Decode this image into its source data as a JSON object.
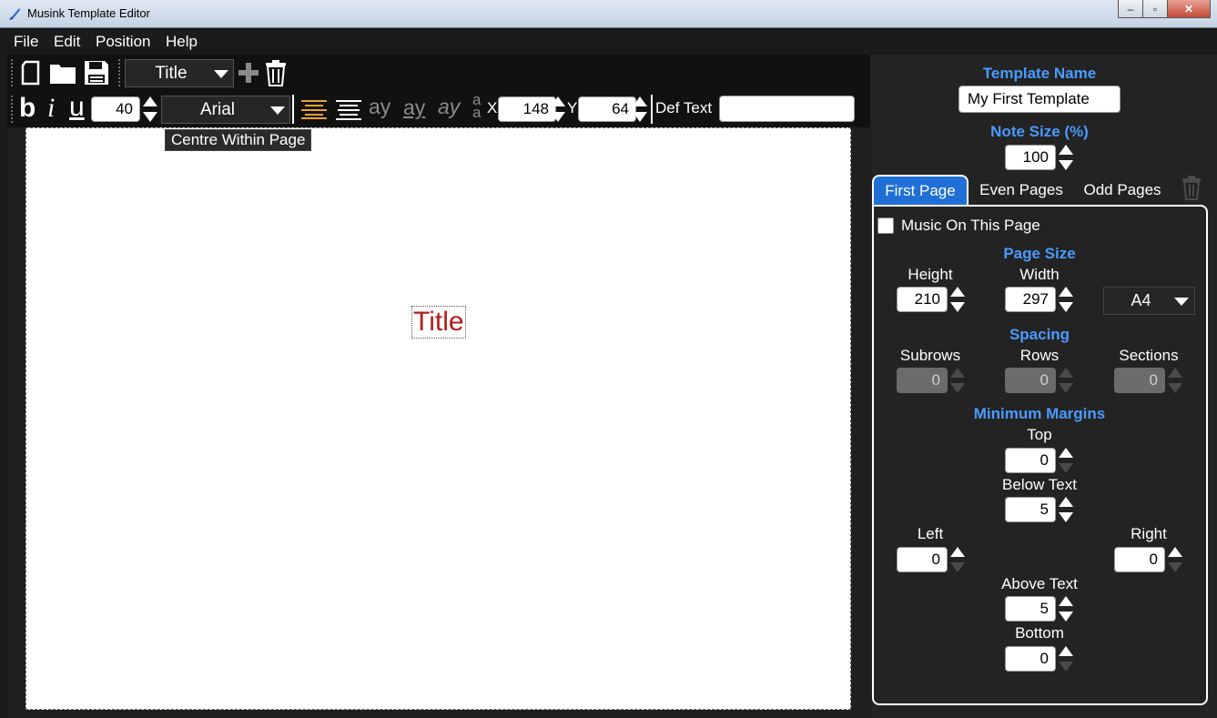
{
  "window": {
    "title": "Musink Template Editor",
    "minimize": "‒",
    "maximize": "▫",
    "close": "✕"
  },
  "menu": {
    "file": "File",
    "edit": "Edit",
    "position": "Position",
    "help": "Help"
  },
  "toolbar": {
    "element_select": "Title",
    "bold": "b",
    "italic": "i",
    "underline": "u",
    "font_size": "40",
    "font": "Arial",
    "style_a": "ay",
    "style_b": "ay",
    "style_c": "ay",
    "style_d": "a",
    "x_label": "X",
    "x_value": "148",
    "y_label": "Y",
    "y_value": "64",
    "def_text_label": "Def Text",
    "def_text_value": "",
    "tooltip": "Centre Within Page"
  },
  "canvas": {
    "title_element": "Title"
  },
  "panel": {
    "template_name_label": "Template Name",
    "template_name_value": "My First Template",
    "note_size_label": "Note Size (%)",
    "note_size_value": "100",
    "tabs": [
      "First Page",
      "Even Pages",
      "Odd Pages"
    ],
    "music_on_page": "Music On This Page",
    "page_size_label": "Page Size",
    "height_label": "Height",
    "height_value": "210",
    "width_label": "Width",
    "width_value": "297",
    "paper_select": "A4",
    "spacing_label": "Spacing",
    "subrows_label": "Subrows",
    "subrows_value": "0",
    "rows_label": "Rows",
    "rows_value": "0",
    "sections_label": "Sections",
    "sections_value": "0",
    "margins_label": "Minimum Margins",
    "top_label": "Top",
    "top_value": "0",
    "below_text_label": "Below Text",
    "below_text_value": "5",
    "left_label": "Left",
    "left_value": "0",
    "right_label": "Right",
    "right_value": "0",
    "above_text_label": "Above Text",
    "above_text_value": "5",
    "bottom_label": "Bottom",
    "bottom_value": "0"
  },
  "colors": {
    "accent": "#1f6fd6",
    "header_text": "#4a9bff",
    "title_element": "#b21d1d",
    "align_active": "#f0a030"
  }
}
